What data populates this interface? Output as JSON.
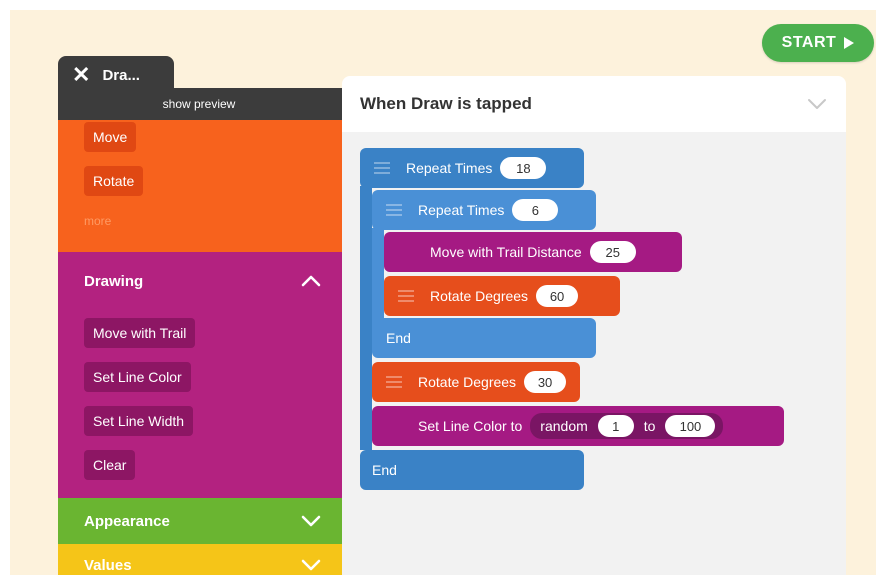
{
  "toolbar": {
    "start_label": "START"
  },
  "tab": {
    "close_glyph": "✕",
    "title": "Dra..."
  },
  "preview": {
    "label": "show preview"
  },
  "palette": {
    "motion": {
      "items": [
        "Move",
        "Rotate"
      ],
      "more": "more"
    },
    "drawing": {
      "title": "Drawing",
      "items": [
        "Move with Trail",
        "Set Line Color",
        "Set Line Width",
        "Clear"
      ]
    },
    "appearance": {
      "title": "Appearance"
    },
    "values": {
      "title": "Values"
    }
  },
  "script": {
    "header": "When Draw is tapped",
    "blocks": {
      "repeat_outer": {
        "label": "Repeat Times",
        "value": "18"
      },
      "repeat_inner": {
        "label": "Repeat Times",
        "value": "6"
      },
      "move_trail": {
        "label": "Move with Trail Distance",
        "value": "25"
      },
      "rotate_inner": {
        "label": "Rotate Degrees",
        "value": "60"
      },
      "end_inner": "End",
      "rotate_outer": {
        "label": "Rotate Degrees",
        "value": "30"
      },
      "set_color": {
        "label": "Set Line Color to",
        "random": "random",
        "from": "1",
        "to_label": "to",
        "to": "100"
      },
      "end_outer": "End"
    }
  },
  "colors": {
    "start_green": "#4cb04e",
    "motion_orange": "#f7621d",
    "drawing_magenta": "#b32280",
    "appearance_green": "#6ab531",
    "values_yellow": "#f5c518",
    "control_blue": "#3a82c6"
  },
  "icons": {
    "close": "close-icon",
    "start": "play-icon",
    "collapse": "chevron-up-icon",
    "expand": "chevron-down-icon",
    "grip": "drag-handle-icon"
  }
}
